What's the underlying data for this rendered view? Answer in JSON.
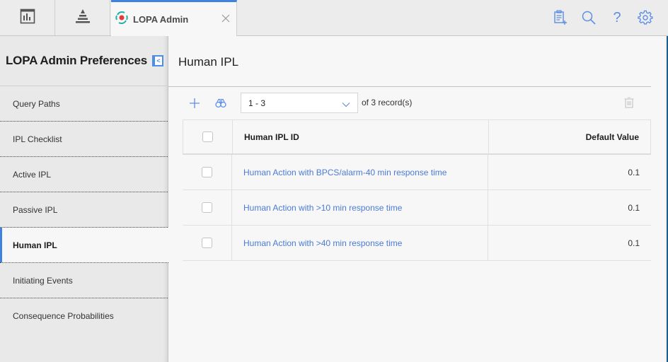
{
  "topbar": {
    "buttons": [
      {
        "icon": "dashboard-icon"
      },
      {
        "icon": "lopa-pyramid-icon"
      }
    ],
    "active_tab": {
      "title": "LOPA Admin",
      "icon": "lopa-admin-icon",
      "close_icon": "close-icon"
    },
    "actions": [
      {
        "icon": "clipboard-add-icon"
      },
      {
        "icon": "search-icon"
      },
      {
        "icon": "help-icon",
        "glyph": "?"
      },
      {
        "icon": "gear-icon"
      }
    ],
    "accent_color": "#3f82e0"
  },
  "sidebar": {
    "title": "LOPA Admin Preferences",
    "collapse_glyph": "<",
    "items": [
      {
        "label": "Query Paths",
        "active": false
      },
      {
        "label": "IPL Checklist",
        "active": false
      },
      {
        "label": "Active IPL",
        "active": false
      },
      {
        "label": "Passive IPL",
        "active": false
      },
      {
        "label": "Human IPL",
        "active": true
      },
      {
        "label": "Initiating Events",
        "active": false
      },
      {
        "label": "Consequence Probabilities",
        "active": false
      }
    ]
  },
  "main": {
    "title": "Human IPL",
    "toolbar": {
      "add_icon": "plus-icon",
      "find_icon": "binoculars-icon",
      "range_value": "1 - 3",
      "record_count": "of 3 record(s)",
      "delete_icon": "trash-icon"
    },
    "grid": {
      "columns": [
        "Human IPL ID",
        "Default Value"
      ],
      "rows": [
        {
          "id": "Human Action with BPCS/alarm-40 min response time",
          "value": "0.1",
          "checked": false
        },
        {
          "id": "Human Action with >10 min response time",
          "value": "0.1",
          "checked": false
        },
        {
          "id": "Human Action with >40 min response time",
          "value": "0.1",
          "checked": false
        }
      ],
      "link_color": "#4b7bd6"
    }
  }
}
